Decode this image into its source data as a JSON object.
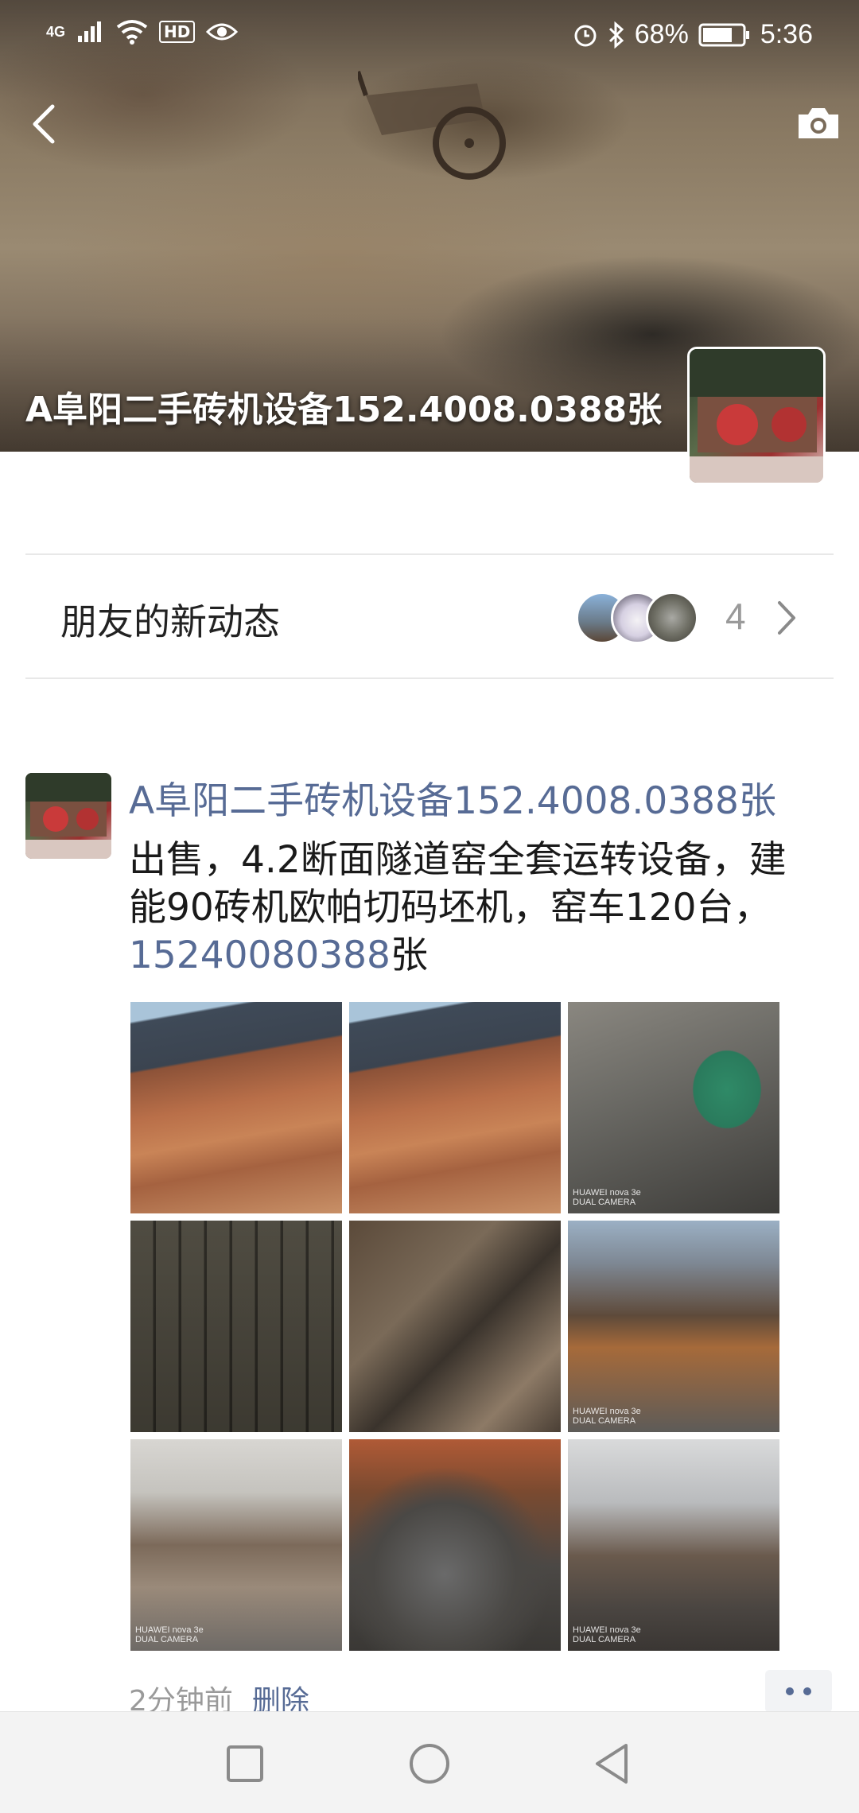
{
  "status_bar": {
    "network": "4G",
    "battery": "68%",
    "time": "5:36"
  },
  "cover": {
    "name": "A阜阳二手砖机设备152.4008.0388张"
  },
  "friends_updates": {
    "label": "朋友的新动态",
    "count": "4"
  },
  "post": {
    "author": "A阜阳二手砖机设备152.4008.0388张",
    "text_before_phone": "出售，4.2断面隧道窑全套运转设备，建能90砖机欧帕切码坯机，窑车120台，",
    "phone": "15240080388",
    "text_after_phone": "张",
    "photo_count": 9,
    "camera_tag": "HUAWEI nova 3e\nDUAL CAMERA",
    "time_ago": "2分钟前",
    "delete_label": "删除"
  },
  "colors": {
    "link": "#576b95",
    "text": "#1a1a1a",
    "muted": "#9a9a9a",
    "nav_bar_bg": "#f3f3f3"
  },
  "icons": [
    "back-arrow-icon",
    "camera-icon",
    "chevron-right-icon",
    "more-dots-icon",
    "recent-apps-icon",
    "home-icon",
    "back-triangle-icon",
    "wifi-icon",
    "signal-icon",
    "bluetooth-icon",
    "alarm-icon",
    "battery-icon",
    "eye-icon"
  ]
}
